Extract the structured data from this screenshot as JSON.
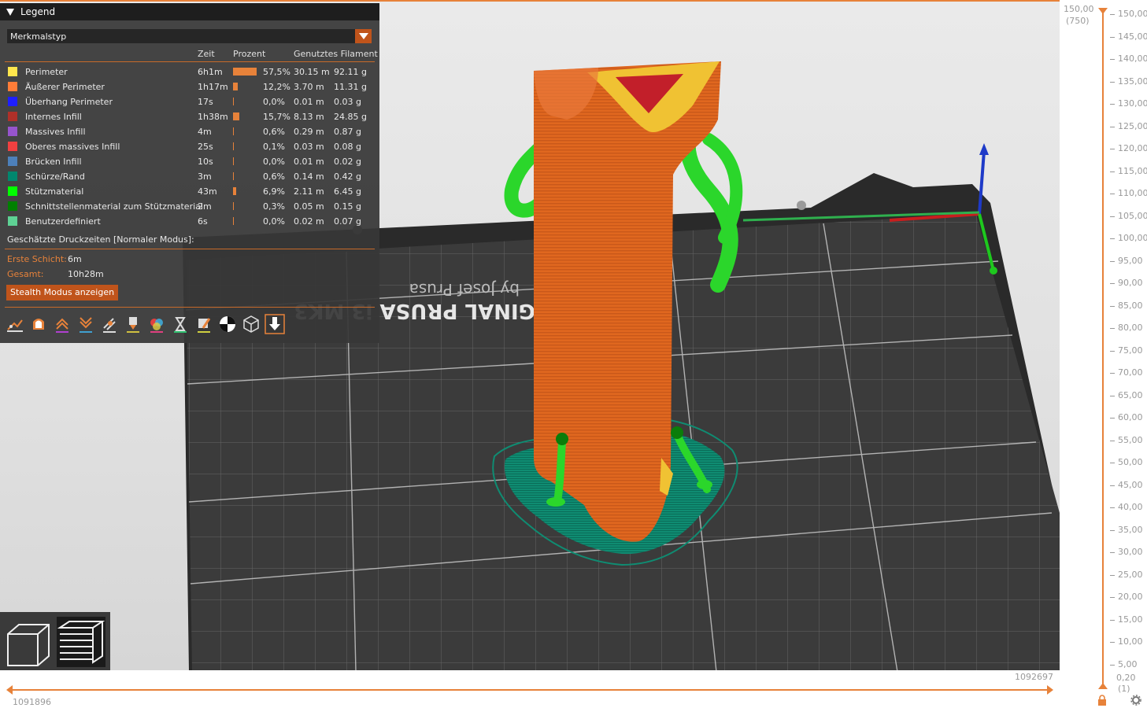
{
  "legend": {
    "title": "Legend",
    "view_type": "Merkmalstyp",
    "columns": {
      "time": "Zeit",
      "percent": "Prozent",
      "filament": "Genutztes Filament"
    },
    "rows": [
      {
        "label": "Perimeter",
        "color": "#ffe64d",
        "time": "6h1m",
        "percent": "57,5%",
        "fraction": 0.575,
        "length": "30.15 m",
        "weight": "92.11 g"
      },
      {
        "label": "Äußerer Perimeter",
        "color": "#ff7d38",
        "time": "1h17m",
        "percent": "12,2%",
        "fraction": 0.122,
        "length": "3.70 m",
        "weight": "11.31 g"
      },
      {
        "label": "Überhang Perimeter",
        "color": "#1f1fff",
        "time": "17s",
        "percent": "0,0%",
        "fraction": 0.0,
        "length": "0.01 m",
        "weight": "0.03 g"
      },
      {
        "label": "Internes Infill",
        "color": "#b03029",
        "time": "1h38m",
        "percent": "15,7%",
        "fraction": 0.157,
        "length": "8.13 m",
        "weight": "24.85 g"
      },
      {
        "label": "Massives Infill",
        "color": "#9654cc",
        "time": "4m",
        "percent": "0,6%",
        "fraction": 0.006,
        "length": "0.29 m",
        "weight": "0.87 g"
      },
      {
        "label": "Oberes massives Infill",
        "color": "#f04040",
        "time": "25s",
        "percent": "0,1%",
        "fraction": 0.001,
        "length": "0.03 m",
        "weight": "0.08 g"
      },
      {
        "label": "Brücken Infill",
        "color": "#4d80ba",
        "time": "10s",
        "percent": "0,0%",
        "fraction": 0.0,
        "length": "0.01 m",
        "weight": "0.02 g"
      },
      {
        "label": "Schürze/Rand",
        "color": "#00876e",
        "time": "3m",
        "percent": "0,6%",
        "fraction": 0.006,
        "length": "0.14 m",
        "weight": "0.42 g"
      },
      {
        "label": "Stützmaterial",
        "color": "#00ff00",
        "time": "43m",
        "percent": "6,9%",
        "fraction": 0.069,
        "length": "2.11 m",
        "weight": "6.45 g"
      },
      {
        "label": "Schnittstellenmaterial zum Stützmaterial",
        "color": "#008000",
        "time": "2m",
        "percent": "0,3%",
        "fraction": 0.003,
        "length": "0.05 m",
        "weight": "0.15 g"
      },
      {
        "label": "Benutzerdefiniert",
        "color": "#5ed194",
        "time": "6s",
        "percent": "0,0%",
        "fraction": 0.0,
        "length": "0.02 m",
        "weight": "0.07 g"
      }
    ],
    "estimated_times_label": "Geschätzte Druckzeiten [Normaler Modus]:",
    "first_layer_label": "Erste Schicht:",
    "first_layer_value": "6m",
    "total_label": "Gesamt:",
    "total_value": "10h28m",
    "stealth_button": "Stealth Modus anzeigen",
    "toolbar_icons": [
      "travel-icon",
      "wipe-icon",
      "retractions-icon",
      "deretractions-icon",
      "seams-icon",
      "tool-changes-icon",
      "color-changes-icon",
      "pause-icon",
      "custom-gcode-icon",
      "center-of-gravity-icon",
      "shells-icon",
      "tool-marker-icon"
    ]
  },
  "bed_text": {
    "line1": "GINAL PRUSA i3 MK3",
    "line2": "by Josef Prusa"
  },
  "vertical_slider": {
    "top_value": "150,00",
    "top_layer": "(750)",
    "bottom_value": "0,20",
    "bottom_layer": "(1)",
    "ticks": [
      "150,00",
      "145,00",
      "140,00",
      "135,00",
      "130,00",
      "125,00",
      "120,00",
      "115,00",
      "110,00",
      "105,00",
      "100,00",
      "95,00",
      "90,00",
      "85,00",
      "80,00",
      "75,00",
      "70,00",
      "65,00",
      "60,00",
      "55,00",
      "50,00",
      "45,00",
      "40,00",
      "35,00",
      "30,00",
      "25,00",
      "20,00",
      "15,00",
      "10,00",
      "5,00"
    ]
  },
  "horizontal_slider": {
    "right_value": "1092697",
    "left_value": "1091896"
  },
  "colors": {
    "accent": "#e7823a",
    "accent_dark": "#c0541b",
    "panel": "#373737"
  }
}
